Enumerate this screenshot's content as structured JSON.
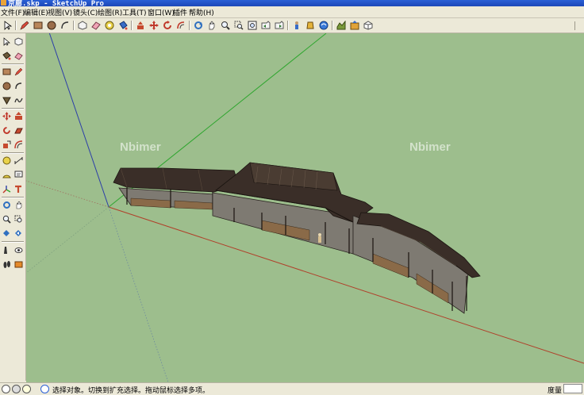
{
  "window": {
    "title": "京廊.skp - SketchUp Pro"
  },
  "menu": [
    "文件(F)",
    "编辑(E)",
    "视图(V)",
    "镜头(C)",
    "绘图(R)",
    "工具(T)",
    "窗口(W)",
    "插件",
    "帮助(H)"
  ],
  "toolbar_icons": [
    "select-icon",
    "pencil-icon",
    "rectangle-icon",
    "circle-icon",
    "arc-icon",
    "make-component-icon",
    "eraser-icon",
    "tape-measure-icon",
    "paint-bucket-icon",
    "push-pull-icon",
    "move-icon",
    "rotate-icon",
    "offset-icon",
    "orbit-icon",
    "pan-icon",
    "zoom-icon",
    "zoom-window-icon",
    "zoom-extents-icon",
    "previous-view-icon",
    "next-view-icon",
    "position-camera-icon",
    "walk-icon",
    "look-around-icon",
    "get-models-icon",
    "share-model-icon",
    "components-icon"
  ],
  "left_toolbar_icons": [
    "select-icon",
    "make-component-icon",
    "paint-bucket-icon",
    "eraser-icon",
    "rectangle-icon",
    "line-icon",
    "circle-icon",
    "arc-icon",
    "polygon-icon",
    "freehand-icon",
    "move-icon",
    "push-pull-icon",
    "rotate-icon",
    "follow-me-icon",
    "scale-icon",
    "offset-icon",
    "tape-measure-icon",
    "dimension-icon",
    "protractor-icon",
    "text-icon",
    "axes-icon",
    "3d-text-icon",
    "orbit-icon",
    "pan-icon",
    "zoom-icon",
    "zoom-window-icon",
    "zoom-extents-icon",
    "previous-view-icon",
    "position-camera-icon",
    "look-around-icon",
    "walk-icon",
    "section-plane-icon"
  ],
  "watermarks": [
    "Nbimer",
    "Nbimer"
  ],
  "status": {
    "text": "选择对象。切换到扩充选择。拖动鼠标选择多项。",
    "measurements_label": "度量"
  },
  "colors": {
    "viewport_bg": "#9DBE8D",
    "axis_red": "#B0402A",
    "axis_green": "#2FA62F",
    "axis_blue": "#2C3FA8",
    "roof": "#3A2E28",
    "wall": "#7E7A72"
  }
}
